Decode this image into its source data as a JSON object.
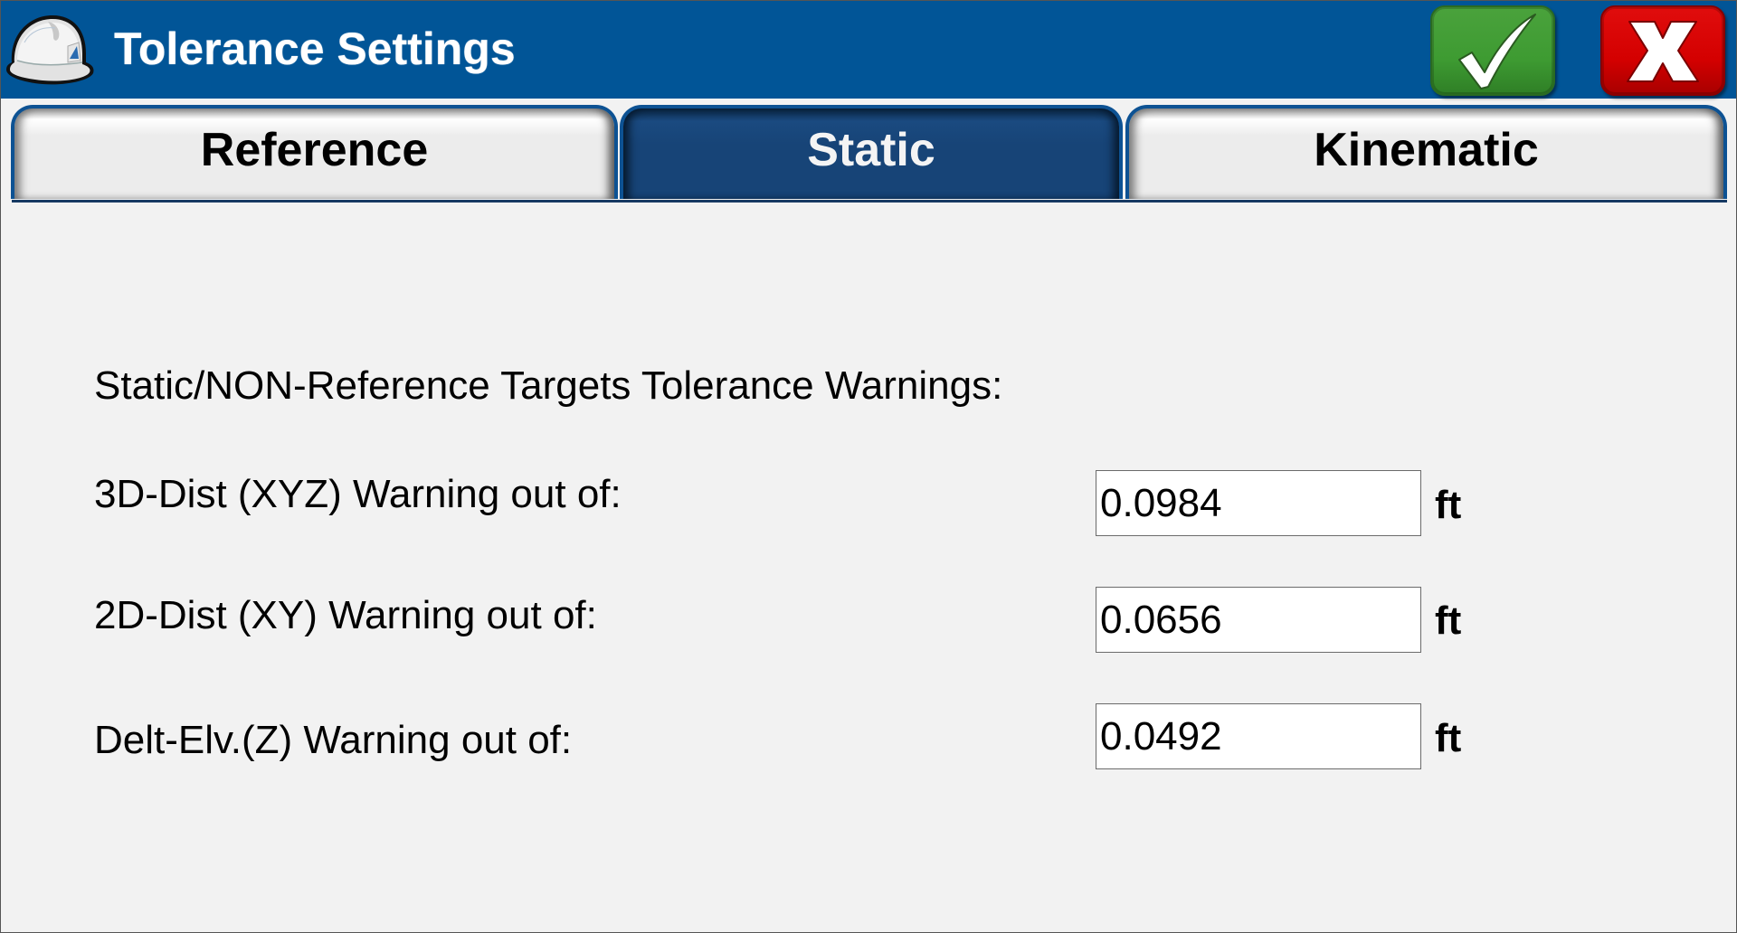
{
  "window": {
    "title": "Tolerance Settings",
    "logo_icon": "hard-hat-icon",
    "ok_icon": "checkmark-icon",
    "cancel_icon": "x-icon",
    "colors": {
      "titlebar": "#015597",
      "ok_button": "#3e9b32",
      "cancel_button": "#d40000",
      "active_tab": "#174477",
      "inactive_tab": "#ececec"
    }
  },
  "tabs": [
    {
      "label": "Reference",
      "active": false
    },
    {
      "label": "Static",
      "active": true
    },
    {
      "label": "Kinematic",
      "active": false
    }
  ],
  "content": {
    "section_title": "Static/NON-Reference Targets Tolerance Warnings:",
    "rows": [
      {
        "label": "3D-Dist (XYZ) Warning out of:",
        "value": "0.0984",
        "unit": "ft"
      },
      {
        "label": "2D-Dist (XY) Warning out of:",
        "value": "0.0656",
        "unit": "ft"
      },
      {
        "label": "Delt-Elv.(Z) Warning out of:",
        "value": "0.0492",
        "unit": "ft"
      }
    ]
  }
}
